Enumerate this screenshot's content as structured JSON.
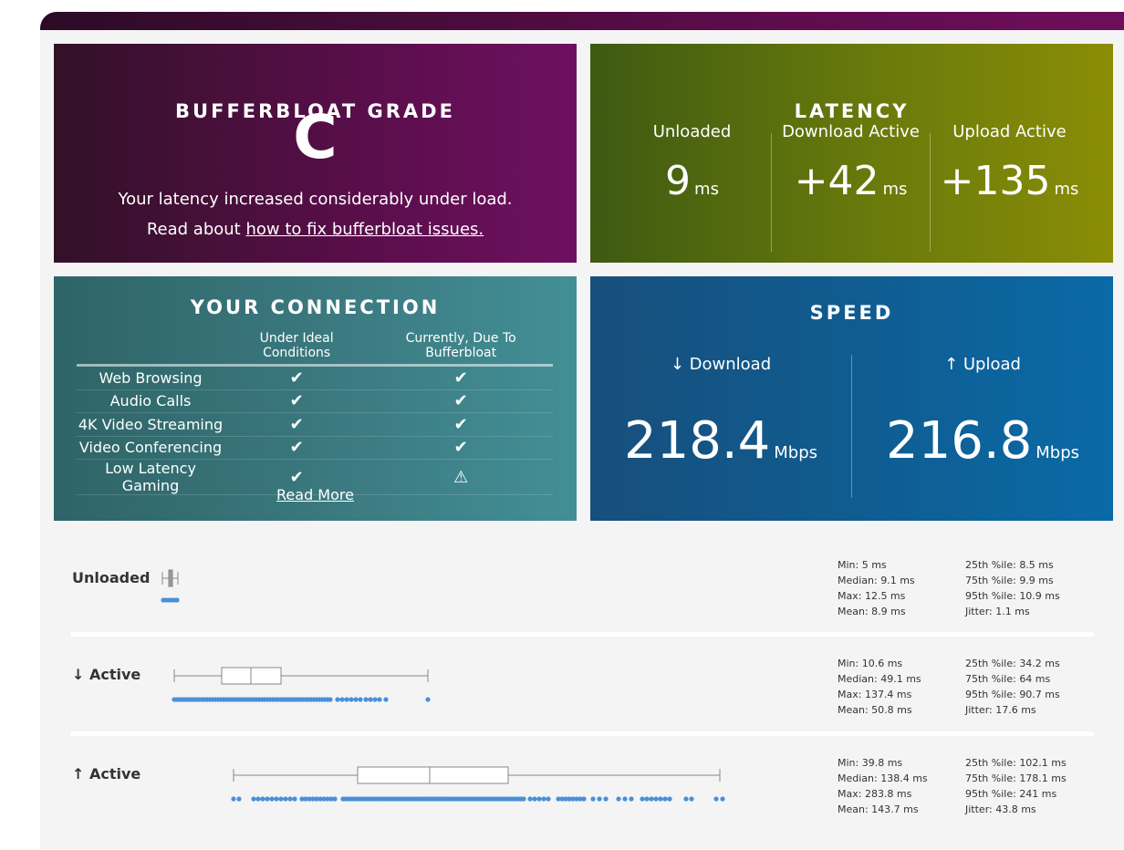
{
  "grade": {
    "title": "BUFFERBLOAT GRADE",
    "letter": "C",
    "message": "Your latency increased considerably under load.",
    "read_prefix": "Read about",
    "read_link": "how to fix bufferbloat issues."
  },
  "latency": {
    "title": "LATENCY",
    "columns": [
      {
        "label": "Unloaded",
        "value": "9",
        "unit": "ms"
      },
      {
        "label": "Download Active",
        "value": "+42",
        "unit": "ms"
      },
      {
        "label": "Upload Active",
        "value": "+135",
        "unit": "ms"
      }
    ]
  },
  "connection": {
    "title": "YOUR CONNECTION",
    "col_ideal": "Under Ideal Conditions",
    "col_current": "Currently, Due To Bufferbloat",
    "rows": [
      {
        "name": "Web Browsing",
        "ideal": "✔",
        "current": "✔"
      },
      {
        "name": "Audio Calls",
        "ideal": "✔",
        "current": "✔"
      },
      {
        "name": "4K Video Streaming",
        "ideal": "✔",
        "current": "✔"
      },
      {
        "name": "Video Conferencing",
        "ideal": "✔",
        "current": "✔"
      },
      {
        "name": "Low Latency Gaming",
        "ideal": "✔",
        "current": "⚠"
      }
    ],
    "read_more": "Read More"
  },
  "speed": {
    "title": "SPEED",
    "download": {
      "label": "↓ Download",
      "value": "218.4",
      "unit": "Mbps"
    },
    "upload": {
      "label": "↑ Upload",
      "value": "216.8",
      "unit": "Mbps"
    }
  },
  "stats": [
    {
      "label": "Unloaded",
      "left": [
        "Min: 5 ms",
        "Median: 9.1 ms",
        "Max: 12.5 ms",
        "Mean: 8.9 ms"
      ],
      "right": [
        "25th %ile: 8.5 ms",
        "75th %ile: 9.9 ms",
        "95th %ile: 10.9 ms",
        "Jitter: 1.1 ms"
      ]
    },
    {
      "label": "↓ Active",
      "left": [
        "Min: 10.6 ms",
        "Median: 49.1 ms",
        "Max: 137.4 ms",
        "Mean: 50.8 ms"
      ],
      "right": [
        "25th %ile: 34.2 ms",
        "75th %ile: 64 ms",
        "95th %ile: 90.7 ms",
        "Jitter: 17.6 ms"
      ]
    },
    {
      "label": "↑ Active",
      "left": [
        "Min: 39.8 ms",
        "Median: 138.4 ms",
        "Max: 283.8 ms",
        "Mean: 143.7 ms"
      ],
      "right": [
        "25th %ile: 102.1 ms",
        "75th %ile: 178.1 ms",
        "95th %ile: 241 ms",
        "Jitter: 43.8 ms"
      ]
    }
  ],
  "colors": {
    "dot": "#4a90d9",
    "box": "#888888"
  }
}
